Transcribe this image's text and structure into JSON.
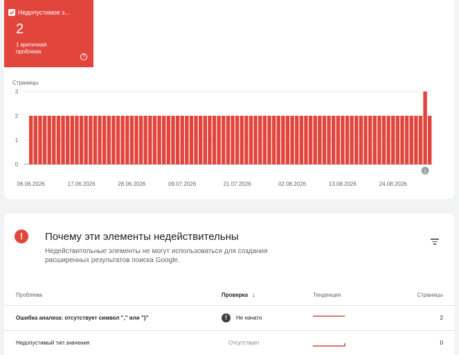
{
  "tile": {
    "title": "Недопустимое з...",
    "count": "2",
    "subtitle": "1 критичная проблема",
    "help": "?",
    "color": "#e2453c"
  },
  "chart_data": {
    "type": "bar",
    "ylabel": "Страницы",
    "ylim": [
      0,
      3
    ],
    "yticks": [
      "0",
      "1",
      "2",
      "3"
    ],
    "xtick_labels": [
      "06.06.2026",
      "17.06.2026",
      "28.06.2026",
      "09.07.2026",
      "21.07.2026",
      "02.08.2026",
      "13.08.2026",
      "24.08.2026"
    ],
    "xtick_index": [
      0,
      11,
      22,
      33,
      45,
      57,
      68,
      79
    ],
    "values": [
      2,
      2,
      2,
      2,
      2,
      2,
      2,
      2,
      2,
      2,
      2,
      2,
      2,
      2,
      2,
      2,
      2,
      2,
      2,
      2,
      2,
      2,
      2,
      2,
      2,
      2,
      2,
      2,
      2,
      2,
      2,
      2,
      2,
      2,
      2,
      2,
      2,
      2,
      2,
      2,
      2,
      2,
      2,
      2,
      2,
      2,
      2,
      2,
      2,
      2,
      2,
      2,
      2,
      2,
      2,
      2,
      2,
      2,
      2,
      2,
      2,
      2,
      2,
      2,
      2,
      2,
      2,
      2,
      2,
      2,
      2,
      2,
      2,
      2,
      2,
      2,
      2,
      2,
      2,
      2,
      2,
      2,
      2,
      2,
      2,
      2,
      3,
      2
    ],
    "bar_color": "#e2453c",
    "annotation": {
      "label": "1",
      "index": 86
    },
    "grid": true
  },
  "section": {
    "title": "Почему эти элементы недействительны",
    "description": "Недействительные элементы не могут использоваться для создания расширенных результатов поиска Google."
  },
  "table": {
    "headers": {
      "issue": "Проблема",
      "check": "Проверка",
      "trend": "Тенденция",
      "pages": "Страницы"
    },
    "rows": [
      {
        "issue": "Ошибка анализа: отсутствует символ \",\" или \"}\"",
        "status": "Не начато",
        "pages": "2",
        "status_icon": "!"
      },
      {
        "issue": "Недопустимый тип значения",
        "status": "Отсутствует",
        "pages": "0"
      }
    ]
  }
}
